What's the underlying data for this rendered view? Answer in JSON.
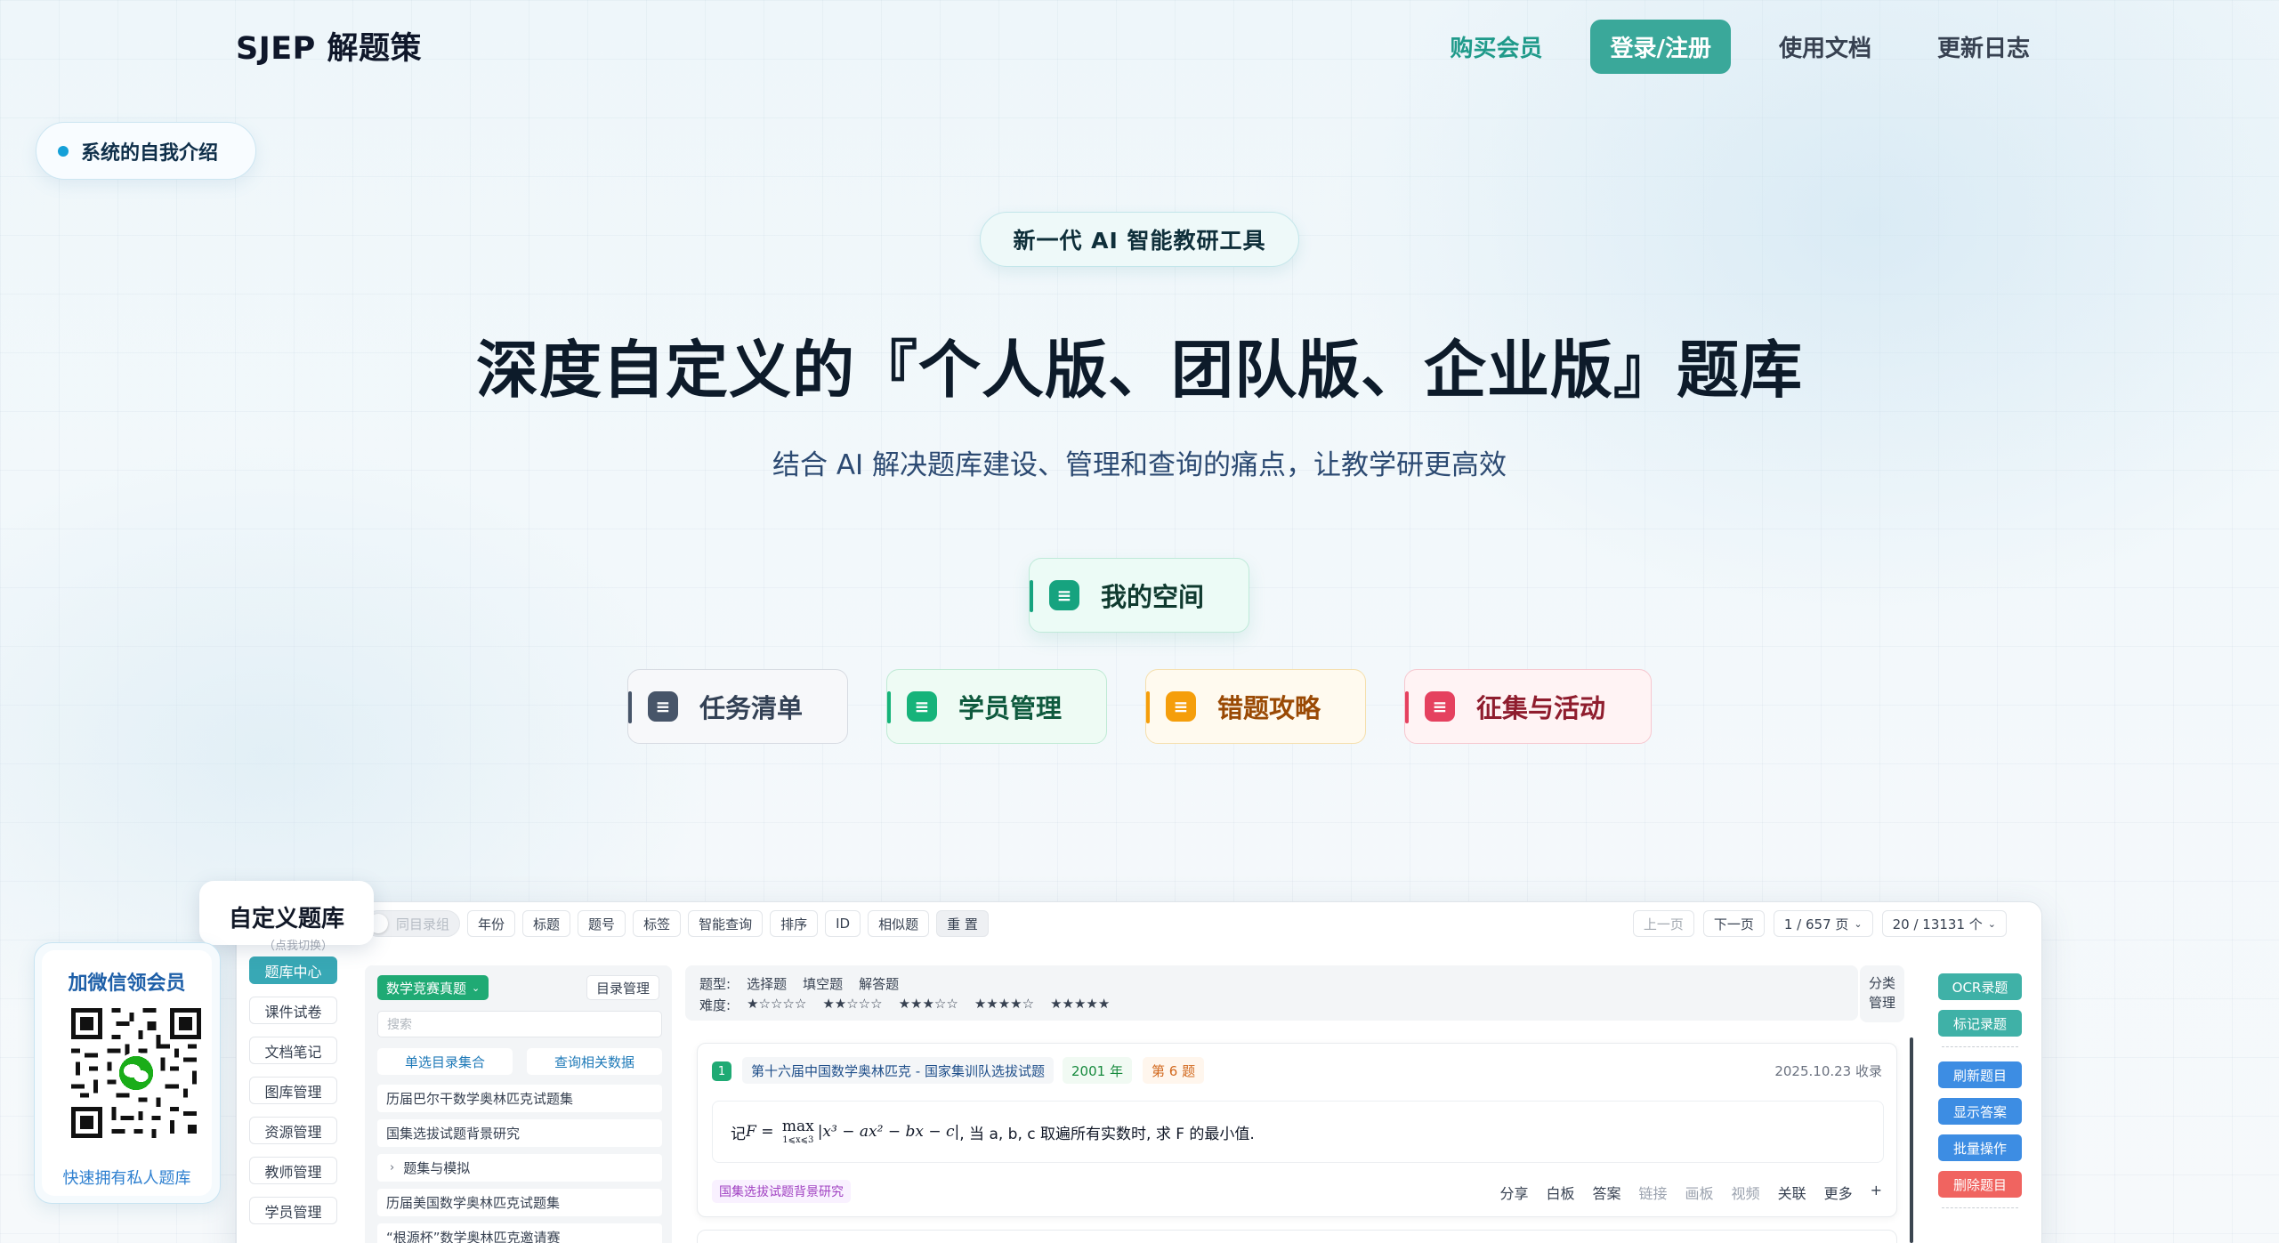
{
  "brand": "SJEP 解题策",
  "nav": {
    "buy": "购买会员",
    "login": "登录/注册",
    "docs": "使用文档",
    "changelog": "更新日志"
  },
  "intro_pill": "系统的自我介绍",
  "badge": "新一代 AI 智能教研工具",
  "hero": {
    "title": "深度自定义的『个人版、团队版、企业版』题库",
    "subtitle": "结合 AI 解决题库建设、管理和查询的痛点，让教学研更高效"
  },
  "features": {
    "space": "我的空间",
    "tasks": "任务清单",
    "students": "学员管理",
    "mistakes": "错题攻略",
    "collect": "征集与活动"
  },
  "colors": {
    "accent": "#3aa89a",
    "space": "#16a37f",
    "tasks": "#475569",
    "students": "#16b37a",
    "mistakes": "#f59e0b",
    "collect": "#e5415f"
  },
  "preview": {
    "tab_title": "自定义题库",
    "tab_sub": "（点我切换）",
    "toolbar": {
      "toggle": "同目录组",
      "items": [
        "年份",
        "标题",
        "题号",
        "标签",
        "智能查询",
        "排序",
        "ID",
        "相似题"
      ],
      "reset": "重 置"
    },
    "pager": {
      "prev": "上一页",
      "next": "下一页",
      "page": "1 / 657 页",
      "count": "20 / 13131 个"
    },
    "sidebar": [
      "题库中心",
      "课件试卷",
      "文档笔记",
      "图库管理",
      "资源管理",
      "教师管理",
      "学员管理"
    ],
    "directory": {
      "select": "数学竞赛真题",
      "manage": "目录管理",
      "search_placeholder": "搜索",
      "btn_select": "单选目录集合",
      "btn_query": "查询相关数据",
      "rows": [
        "历届巴尔干数学奥林匹克试题集",
        "国集选拔试题背景研究",
        "题集与模拟",
        "历届美国数学奥林匹克试题集",
        "“根源杯”数学奥林匹克邀请赛"
      ]
    },
    "filter": {
      "type_label": "题型:",
      "types": [
        "选择题",
        "填空题",
        "解答题"
      ],
      "diff_label": "难度:",
      "diffs": [
        "★☆☆☆☆",
        "★★☆☆☆",
        "★★★☆☆",
        "★★★★☆",
        "★★★★★"
      ],
      "classify": [
        "分类",
        "管理"
      ]
    },
    "question": {
      "num": "1",
      "source": "第十六届中国数学奥林匹克 - 国家集训队选拔试题",
      "year": "2001 年",
      "order": "第 6 题",
      "date": "2025.10.23 收录",
      "text_pre": "记 ",
      "formula_var": "F",
      "formula_eq": " = ",
      "formula_op": "max",
      "formula_sub": "1⩽x⩽3",
      "formula_body": "|x³ − ax² − bx − c|",
      "text_post": ", 当 a, b, c 取遍所有实数时, 求 F 的最小值.",
      "tag": "国集选拔试题背景研究",
      "actions": [
        "分享",
        "白板",
        "答案",
        "链接",
        "画板",
        "视频",
        "关联",
        "更多",
        "+"
      ]
    },
    "right_buttons": [
      "OCR录题",
      "标记录题",
      "刷新题目",
      "显示答案",
      "批量操作",
      "删除题目"
    ]
  },
  "wechat": {
    "title": "加微信领会员",
    "caption": "快速拥有私人题库"
  }
}
